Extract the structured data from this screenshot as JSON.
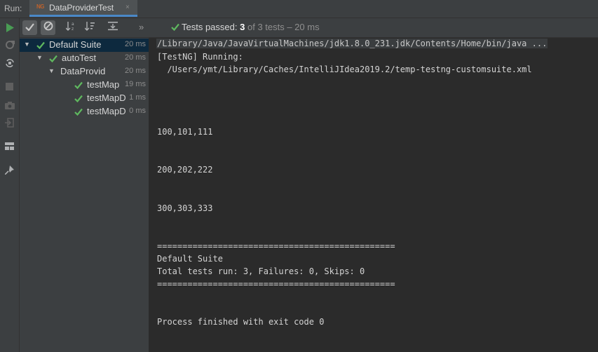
{
  "header": {
    "run_label": "Run:",
    "tab_icon_text": "NG",
    "tab_title": "DataProviderTest",
    "tab_close": "×"
  },
  "leftbar": {
    "icons": [
      "rerun-icon",
      "rerun-failed-icon",
      "toggle-auto-test-icon",
      "stop-icon",
      "screenshot-icon",
      "exit-icon",
      "layout-icon",
      "pin-icon"
    ]
  },
  "toolbar": {
    "show_passed_icon": "checkmark-icon",
    "show_ignored_icon": "ignored-icon",
    "sort_alpha_icon": "sort-alphabetically-icon",
    "sort_duration_icon": "sort-by-duration-icon",
    "expand_all_icon": "expand-all-icon",
    "more_icon": "more-chevron-icon",
    "more_label": "»"
  },
  "status": {
    "prefix": "Tests passed:",
    "passed": "3",
    "rest": "of 3 tests – 20 ms"
  },
  "tree": [
    {
      "name": "Default Suite",
      "time": "20 ms",
      "level": 0,
      "expanded": true,
      "selected": true
    },
    {
      "name": "autoTest",
      "time": "20 ms",
      "level": 1,
      "expanded": true,
      "selected": false
    },
    {
      "name": "DataProvid",
      "time": "20 ms",
      "level": 2,
      "expanded": true,
      "selected": false
    },
    {
      "name": "testMap",
      "time": "19 ms",
      "level": 3,
      "expanded": false,
      "selected": false
    },
    {
      "name": "testMapD",
      "time": "1 ms",
      "level": 3,
      "expanded": false,
      "selected": false
    },
    {
      "name": "testMapD",
      "time": "0 ms",
      "level": 3,
      "expanded": false,
      "selected": false
    }
  ],
  "console": {
    "command": "/Library/Java/JavaVirtualMachines/jdk1.8.0_231.jdk/Contents/Home/bin/java ...",
    "running": "[TestNG] Running:",
    "suite_path": "  /Users/ymt/Library/Caches/IntelliJIdea2019.2/temp-testng-customsuite.xml",
    "out1": "100,101,111",
    "out2": "200,202,222",
    "out3": "300,303,333",
    "separator1": "===============================================",
    "suite_name": "Default Suite",
    "summary": "Total tests run: 3, Failures: 0, Skips: 0",
    "separator2": "===============================================",
    "finished": "Process finished with exit code 0"
  },
  "colors": {
    "pass_green": "#5fb85f",
    "run_green": "#499c54",
    "selection": "#0d293e",
    "accent_underline": "#4a88c7"
  }
}
